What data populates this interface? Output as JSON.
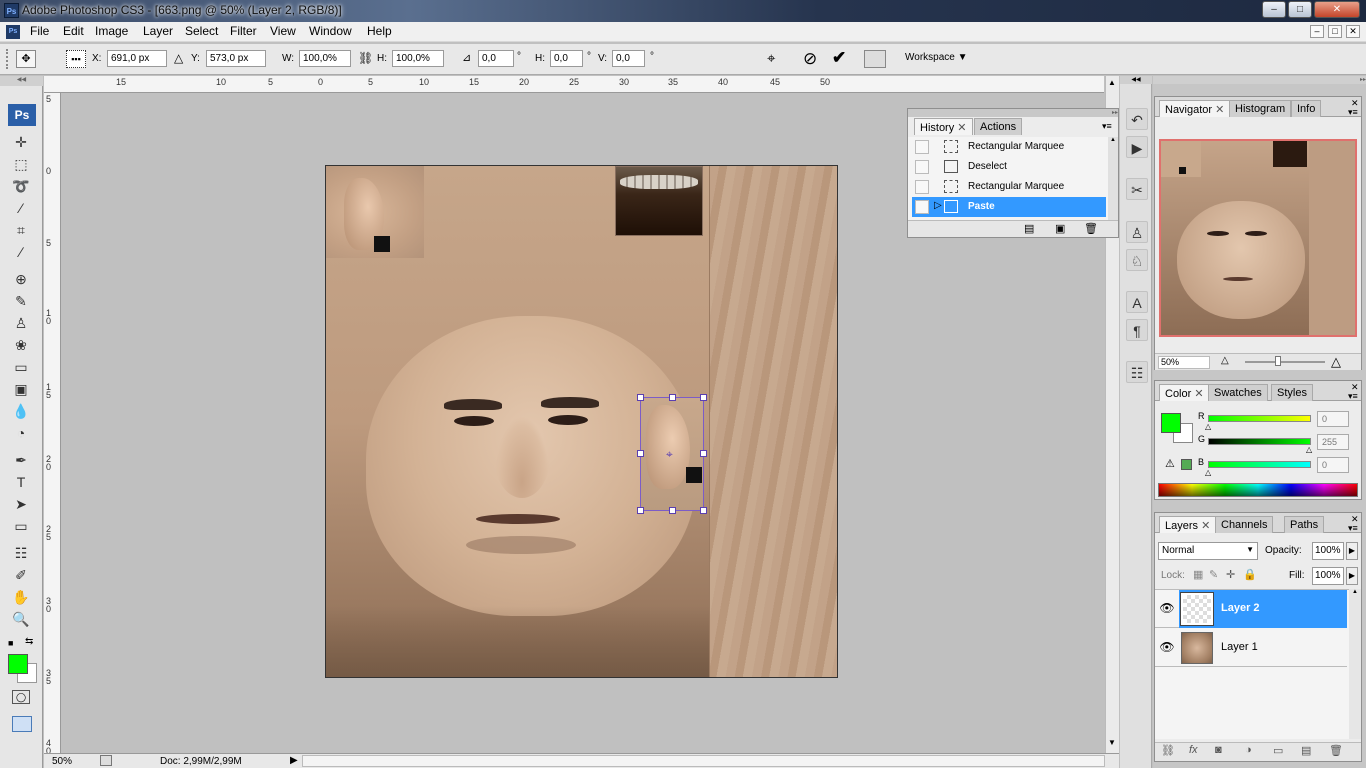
{
  "window": {
    "title": "Adobe Photoshop CS3 - [663.png @ 50% (Layer 2, RGB/8)]",
    "app_icon": "Ps",
    "min_label": "‒",
    "max_label": "□",
    "close_label": "✕",
    "doc_min_label": "‒",
    "doc_restore_label": "□",
    "doc_close_label": "✕"
  },
  "menu": [
    "File",
    "Edit",
    "Image",
    "Layer",
    "Select",
    "Filter",
    "View",
    "Window",
    "Help"
  ],
  "options": {
    "x_label": "X:",
    "x_value": "691,0 px",
    "y_label": "Y:",
    "y_value": "573,0 px",
    "w_label": "W:",
    "w_value": "100,0%",
    "h_label": "H:",
    "h_value": "100,0%",
    "angle_value": "0,0",
    "angle_unit": "°",
    "hskew_label": "H:",
    "hskew_value": "0,0",
    "hskew_unit": "°",
    "vskew_label": "V:",
    "vskew_value": "0,0",
    "vskew_unit": "°",
    "workspace_label": "Workspace"
  },
  "ruler_top": [
    "15",
    "10",
    "5",
    "0",
    "5",
    "10",
    "15",
    "20",
    "25",
    "30",
    "35",
    "40",
    "45",
    "50"
  ],
  "ruler_left": [
    "5",
    "0",
    "5",
    "1 0",
    "1 5",
    "2 0",
    "2 5",
    "3 0",
    "3 5",
    "4 0"
  ],
  "status": {
    "zoom": "50%",
    "doc": "Doc: 2,99M/2,99M"
  },
  "history": {
    "tabs": [
      "History",
      "Actions"
    ],
    "items": [
      "Rectangular Marquee",
      "Deselect",
      "Rectangular Marquee",
      "Paste"
    ],
    "selected_index": 3
  },
  "navigator": {
    "tabs": [
      "Navigator",
      "Histogram",
      "Info"
    ],
    "zoom": "50%"
  },
  "color": {
    "tabs": [
      "Color",
      "Swatches",
      "Styles"
    ],
    "r_label": "R",
    "r_value": "0",
    "g_label": "G",
    "g_value": "255",
    "b_label": "B",
    "b_value": "0",
    "foreground": "#00ff00",
    "background": "#ffffff"
  },
  "layers": {
    "tabs": [
      "Layers",
      "Channels",
      "Paths"
    ],
    "blend_mode": "Normal",
    "opacity_label": "Opacity:",
    "opacity_value": "100%",
    "lock_label": "Lock:",
    "fill_label": "Fill:",
    "fill_value": "100%",
    "items": [
      "Layer 2",
      "Layer 1"
    ],
    "selected_index": 0
  },
  "colors": {
    "selection": "#3399ff",
    "accent_green": "#00ff00"
  }
}
